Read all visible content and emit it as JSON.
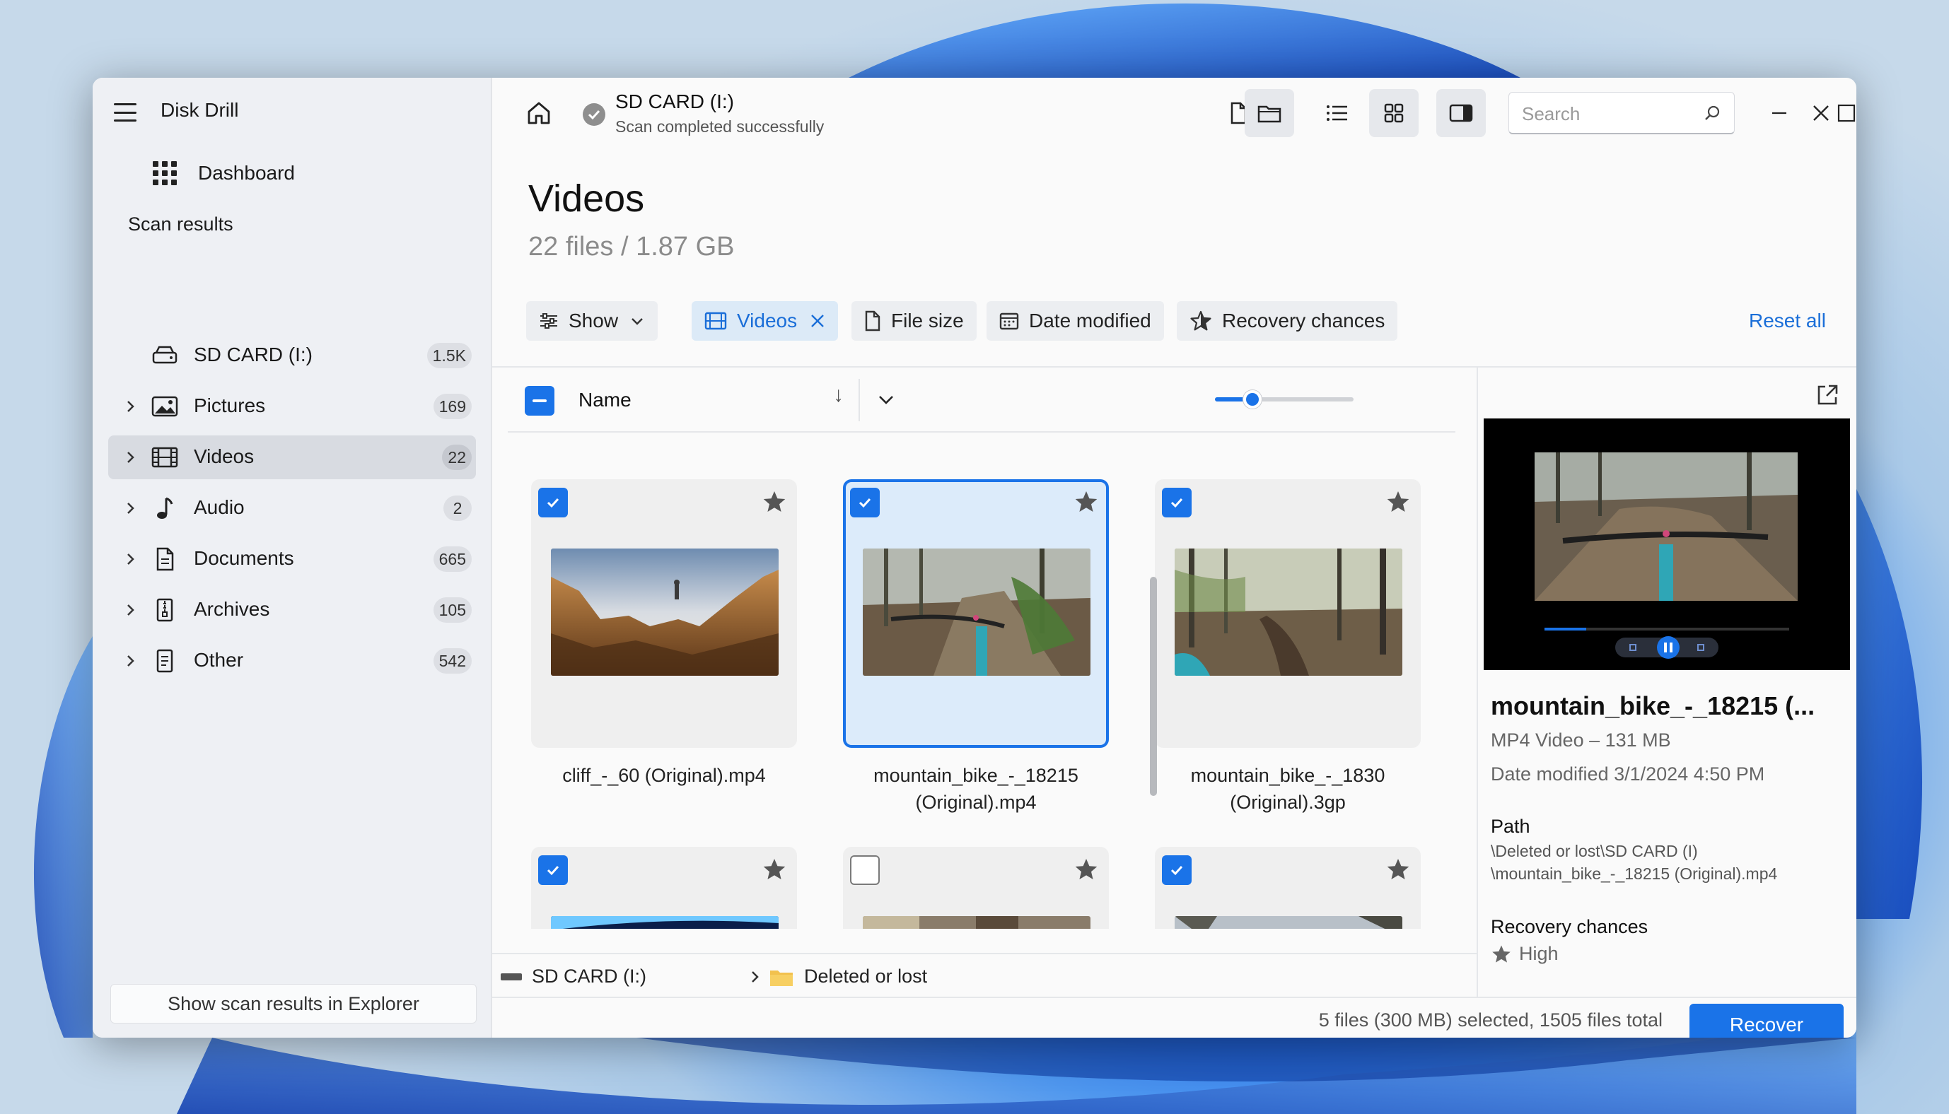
{
  "app": {
    "title": "Disk Drill"
  },
  "sidebar": {
    "dashboard_label": "Dashboard",
    "section_title": "Scan results",
    "items": [
      {
        "label": "SD CARD (I:)",
        "count": "1.5K",
        "icon": "drive-icon"
      },
      {
        "label": "Pictures",
        "count": "169",
        "icon": "image-icon"
      },
      {
        "label": "Videos",
        "count": "22",
        "icon": "film-icon",
        "active": true
      },
      {
        "label": "Audio",
        "count": "2",
        "icon": "music-note-icon"
      },
      {
        "label": "Documents",
        "count": "665",
        "icon": "document-icon"
      },
      {
        "label": "Archives",
        "count": "105",
        "icon": "archive-icon"
      },
      {
        "label": "Other",
        "count": "542",
        "icon": "file-icon"
      }
    ],
    "explorer_button": "Show scan results in Explorer"
  },
  "topbar": {
    "device_title": "SD CARD (I:)",
    "device_status": "Scan completed successfully",
    "search_placeholder": "Search"
  },
  "header": {
    "title": "Videos",
    "subtitle": "22 files / 1.87 GB"
  },
  "filters": {
    "show": "Show",
    "videos": "Videos",
    "file_size": "File size",
    "date_modified": "Date modified",
    "recovery_chances": "Recovery chances",
    "reset_all": "Reset all"
  },
  "list": {
    "name_column": "Name",
    "sort_arrow": "↓",
    "thumbnail_size": 0.27,
    "files": [
      {
        "name": "cliff_-_60 (Original).mp4",
        "checked": true,
        "selected": false
      },
      {
        "name": "mountain_bike_-_18215 (Original).mp4",
        "checked": true,
        "selected": true
      },
      {
        "name": "mountain_bike_-_1830 (Original).3gp",
        "checked": true,
        "selected": false
      },
      {
        "name": "",
        "checked": true,
        "selected": false
      },
      {
        "name": "",
        "checked": false,
        "selected": false
      },
      {
        "name": "",
        "checked": true,
        "selected": false
      }
    ]
  },
  "breadcrumb": {
    "drive": "SD CARD (I:)",
    "folder": "Deleted or lost"
  },
  "preview": {
    "name": "mountain_bike_-_18215 (...",
    "type_size": "MP4 Video – 131 MB",
    "date_modified": "Date modified 3/1/2024 4:50 PM",
    "path_label": "Path",
    "path_line1": "\\Deleted or lost\\SD CARD (I)",
    "path_line2": "\\mountain_bike_-_18215 (Original).mp4",
    "recovery_label": "Recovery chances",
    "recovery_value": "High",
    "playback_progress": 0.17
  },
  "footer": {
    "status": "5 files (300 MB) selected, 1505 files total",
    "recover_button": "Recover"
  },
  "colors": {
    "accent": "#1a73e8",
    "sidebar_bg": "#eef0f4",
    "window_bg": "#fafafa"
  }
}
